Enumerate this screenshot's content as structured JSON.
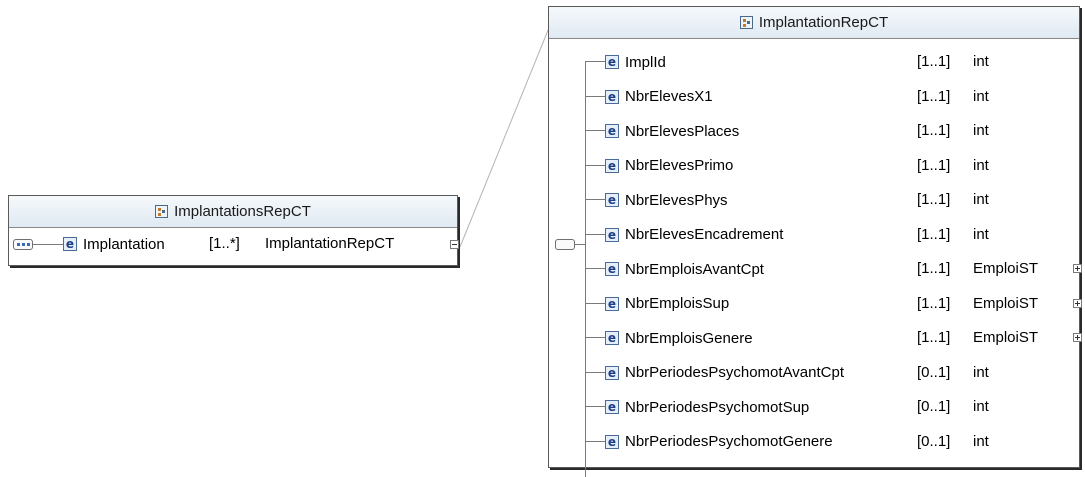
{
  "left_box": {
    "title": "ImplantationsRepCT",
    "element": {
      "name": "Implantation",
      "occurrence": "[1..*]",
      "type": "ImplantationRepCT"
    }
  },
  "right_box": {
    "title": "ImplantationRepCT",
    "elements": [
      {
        "name": "ImplId",
        "occurrence": "[1..1]",
        "type": "int"
      },
      {
        "name": "NbrElevesX1",
        "occurrence": "[1..1]",
        "type": "int"
      },
      {
        "name": "NbrElevesPlaces",
        "occurrence": "[1..1]",
        "type": "int"
      },
      {
        "name": "NbrElevesPrimo",
        "occurrence": "[1..1]",
        "type": "int"
      },
      {
        "name": "NbrElevesPhys",
        "occurrence": "[1..1]",
        "type": "int"
      },
      {
        "name": "NbrElevesEncadrement",
        "occurrence": "[1..1]",
        "type": "int"
      },
      {
        "name": "NbrEmploisAvantCpt",
        "occurrence": "[1..1]",
        "type": "EmploiST"
      },
      {
        "name": "NbrEmploisSup",
        "occurrence": "[1..1]",
        "type": "EmploiST"
      },
      {
        "name": "NbrEmploisGenere",
        "occurrence": "[1..1]",
        "type": "EmploiST"
      },
      {
        "name": "NbrPeriodesPsychomotAvantCpt",
        "occurrence": "[0..1]",
        "type": "int"
      },
      {
        "name": "NbrPeriodesPsychomotSup",
        "occurrence": "[0..1]",
        "type": "int"
      },
      {
        "name": "NbrPeriodesPsychomotGenere",
        "occurrence": "[0..1]",
        "type": "int"
      }
    ]
  },
  "icons": {
    "type_icon": "complex-type-icon",
    "element_badge": "e",
    "sequence": "sequence-compositor-icon",
    "collapse": "collapse-icon",
    "expand": "expand-icon"
  },
  "colors": {
    "header_top": "#f5f9fc",
    "header_bottom": "#e0e9f2",
    "border": "#5a5a5a",
    "badge_text": "#1e3f86"
  }
}
